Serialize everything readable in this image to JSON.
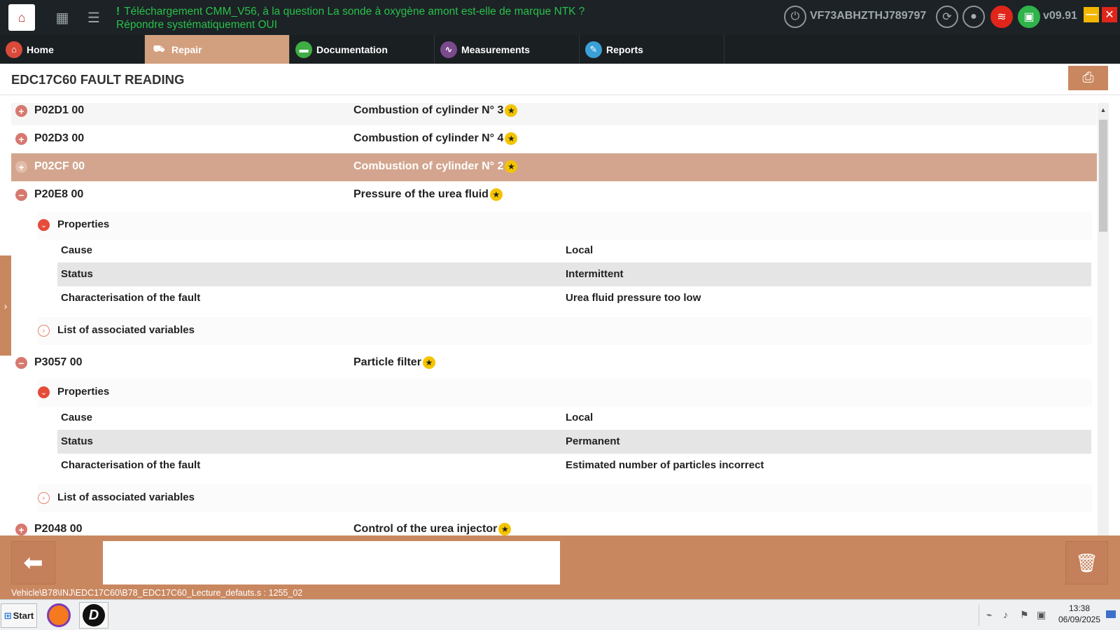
{
  "header": {
    "notification": "Téléchargement CMM_V56, à la question La sonde à oxygène amont est-elle de marque NTK ? Répondre systématiquement OUI",
    "notification_mark": "!",
    "vin": "VF73ABHZTHJ789797",
    "version": "v09.91"
  },
  "nav": {
    "tabs": [
      {
        "label": "Home",
        "icon": "home-icon",
        "color": "#d94a3a"
      },
      {
        "label": "Repair",
        "icon": "cart-icon",
        "color": "#d3a07f"
      },
      {
        "label": "Documentation",
        "icon": "folder-icon",
        "color": "#3fae45"
      },
      {
        "label": "Measurements",
        "icon": "pulse-icon",
        "color": "#7b4a8c"
      },
      {
        "label": "Reports",
        "icon": "document-icon",
        "color": "#3aa0d6"
      }
    ],
    "active_tab": "Repair"
  },
  "page": {
    "title": "EDC17C60 FAULT READING"
  },
  "faults": [
    {
      "code": "P02D1 00",
      "description": "Combustion of cylinder N° 3",
      "expanded": false
    },
    {
      "code": "P02D3 00",
      "description": "Combustion of cylinder N° 4",
      "expanded": false
    },
    {
      "code": "P02CF 00",
      "description": "Combustion of cylinder N° 2",
      "expanded": false,
      "selected": true
    },
    {
      "code": "P20E8 00",
      "description": "Pressure of the urea fluid",
      "expanded": true,
      "properties_label": "Properties",
      "properties": [
        {
          "key": "Cause",
          "value": "Local"
        },
        {
          "key": "Status",
          "value": "Intermittent"
        },
        {
          "key": "Characterisation of the fault",
          "value": "Urea fluid pressure too low"
        }
      ],
      "variables_label": "List of associated variables"
    },
    {
      "code": "P3057 00",
      "description": "Particle filter",
      "expanded": true,
      "properties_label": "Properties",
      "properties": [
        {
          "key": "Cause",
          "value": "Local"
        },
        {
          "key": "Status",
          "value": "Permanent"
        },
        {
          "key": "Characterisation of the fault",
          "value": "Estimated number of particles incorrect"
        }
      ],
      "variables_label": "List of associated variables"
    },
    {
      "code": "P2048 00",
      "description": "Control of the urea injector",
      "expanded": false
    }
  ],
  "footer": {
    "path": "Vehicle\\B78\\INJ\\EDC17C60\\B78_EDC17C60_Lecture_defauts.s : 1255_02",
    "message": ""
  },
  "taskbar": {
    "start_label": "Start",
    "time": "13:38",
    "date": "06/09/2025"
  },
  "colors": {
    "accent": "#c98760",
    "selected_row": "#d3a58e",
    "notification": "#29c04a",
    "topbar": "#1c2226"
  }
}
